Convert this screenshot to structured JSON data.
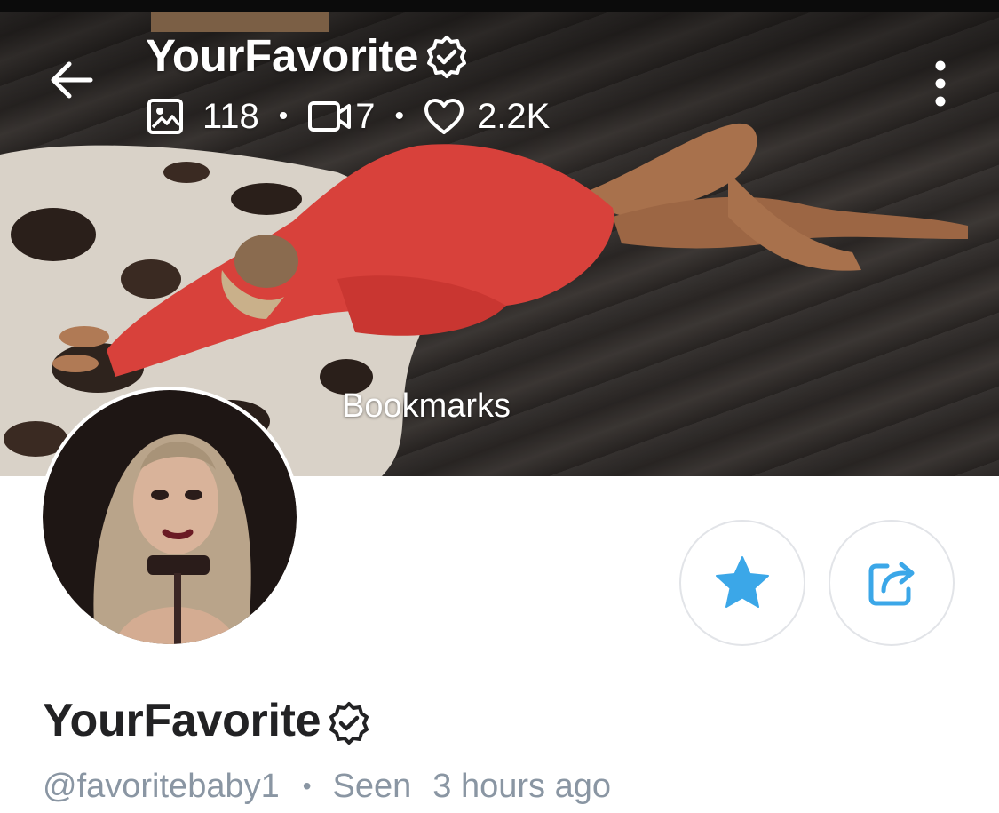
{
  "cover": {
    "title": "YourFavorite",
    "stats": {
      "photos": "118",
      "videos": "7",
      "likes": "2.2K"
    },
    "overlay_label": "Bookmarks"
  },
  "icons": {
    "back": "arrow-left-icon",
    "verified": "verified-badge-icon",
    "photo": "image-icon",
    "video": "video-camera-icon",
    "likes": "heart-icon",
    "more": "more-vertical-icon",
    "star": "star-icon",
    "share": "share-icon"
  },
  "profile": {
    "name": "YourFavorite",
    "handle": "@favoritebaby1",
    "seen_label": "Seen",
    "seen_time": "3 hours ago"
  },
  "colors": {
    "accent": "#3ba7e8",
    "text": "#222224",
    "muted": "#8a96a3"
  }
}
